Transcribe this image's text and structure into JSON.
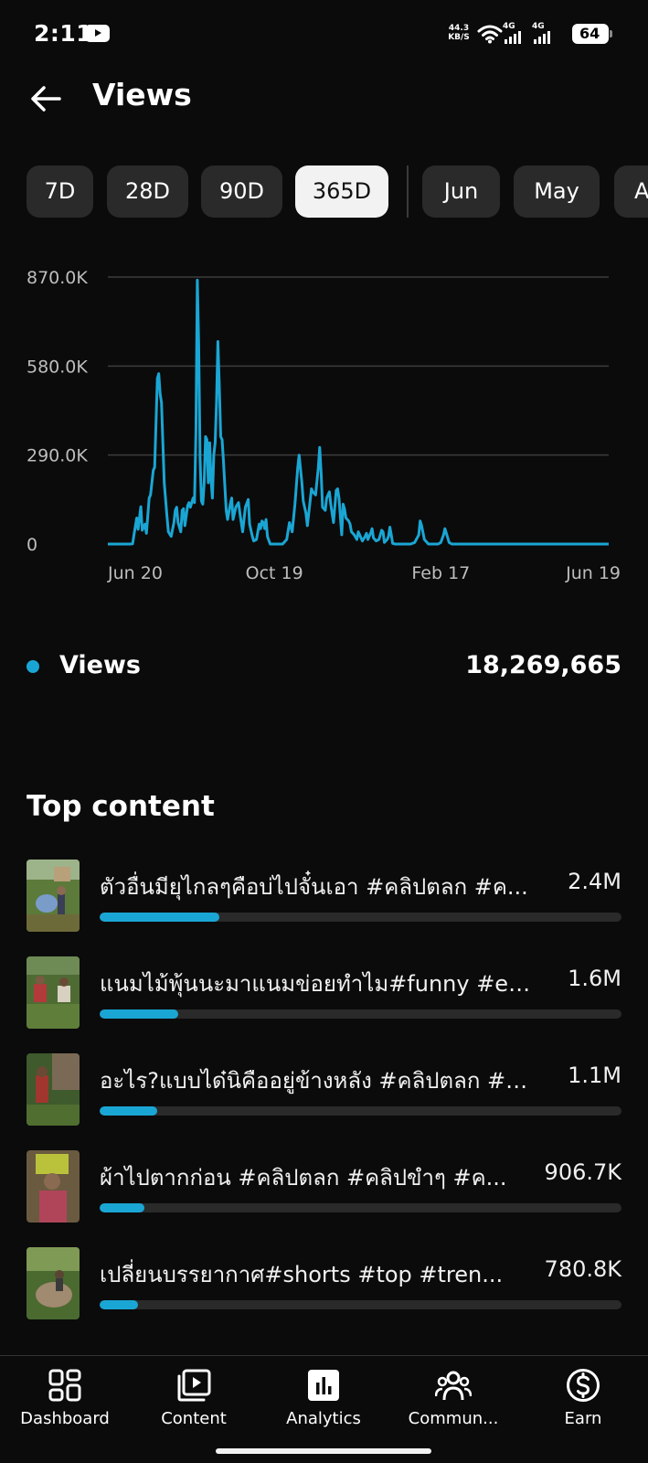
{
  "status_bar": {
    "time": "2:11",
    "net_speed_value": "44.3",
    "net_speed_unit": "KB/S",
    "signal1_label": "4G",
    "signal2_label": "4G",
    "battery": "64"
  },
  "header": {
    "title": "Views"
  },
  "periods": [
    {
      "label": "7D",
      "active": false
    },
    {
      "label": "28D",
      "active": false
    },
    {
      "label": "90D",
      "active": false
    },
    {
      "label": "365D",
      "active": true
    },
    {
      "label": "Jun",
      "active": false
    },
    {
      "label": "May",
      "active": false
    },
    {
      "label": "A",
      "active": false
    }
  ],
  "colors": {
    "accent": "#1aa6d4",
    "background": "#0b0b0b",
    "chip": "#2a2a2a",
    "chip_active": "#f2f2f2",
    "grid": "#3d3d3d"
  },
  "chart_data": {
    "type": "line",
    "title": "",
    "xlabel": "",
    "ylabel": "",
    "y_ticks": [
      "870.0K",
      "580.0K",
      "290.0K",
      "0"
    ],
    "y_tick_values": [
      870000,
      580000,
      290000,
      0
    ],
    "x_ticks": [
      "Jun 20",
      "Oct 19",
      "Feb 17",
      "Jun 19"
    ],
    "x_tick_days": [
      0,
      121,
      242,
      364
    ],
    "ylim": [
      0,
      870000
    ],
    "xlim": [
      0,
      364
    ],
    "grid": true,
    "series": [
      {
        "name": "Views",
        "points": [
          [
            0,
            0
          ],
          [
            16,
            0
          ],
          [
            18,
            1000
          ],
          [
            19,
            30000
          ],
          [
            21,
            85000
          ],
          [
            22,
            48000
          ],
          [
            24,
            122000
          ],
          [
            25,
            45000
          ],
          [
            27,
            65000
          ],
          [
            28,
            35000
          ],
          [
            30,
            150000
          ],
          [
            31,
            160000
          ],
          [
            33,
            240000
          ],
          [
            34,
            250000
          ],
          [
            36,
            540000
          ],
          [
            37,
            555000
          ],
          [
            38,
            490000
          ],
          [
            39,
            460000
          ],
          [
            41,
            200000
          ],
          [
            43,
            90000
          ],
          [
            44,
            40000
          ],
          [
            46,
            25000
          ],
          [
            48,
            70000
          ],
          [
            49,
            110000
          ],
          [
            50,
            120000
          ],
          [
            51,
            70000
          ],
          [
            53,
            40000
          ],
          [
            54,
            110000
          ],
          [
            55,
            115000
          ],
          [
            56,
            60000
          ],
          [
            58,
            125000
          ],
          [
            59,
            135000
          ],
          [
            60,
            120000
          ],
          [
            62,
            150000
          ],
          [
            63,
            135000
          ],
          [
            64,
            370000
          ],
          [
            65,
            860000
          ],
          [
            66,
            650000
          ],
          [
            67,
            280000
          ],
          [
            68,
            140000
          ],
          [
            69,
            130000
          ],
          [
            70,
            200000
          ],
          [
            71,
            350000
          ],
          [
            72,
            340000
          ],
          [
            73,
            200000
          ],
          [
            74,
            330000
          ],
          [
            75,
            210000
          ],
          [
            76,
            150000
          ],
          [
            77,
            290000
          ],
          [
            78,
            330000
          ],
          [
            79,
            460000
          ],
          [
            80,
            660000
          ],
          [
            81,
            520000
          ],
          [
            82,
            350000
          ],
          [
            83,
            340000
          ],
          [
            84,
            270000
          ],
          [
            86,
            110000
          ],
          [
            87,
            80000
          ],
          [
            89,
            130000
          ],
          [
            90,
            150000
          ],
          [
            91,
            80000
          ],
          [
            93,
            120000
          ],
          [
            95,
            135000
          ],
          [
            96,
            100000
          ],
          [
            98,
            40000
          ],
          [
            99,
            80000
          ],
          [
            100,
            120000
          ],
          [
            102,
            145000
          ],
          [
            103,
            65000
          ],
          [
            105,
            25000
          ],
          [
            106,
            10000
          ],
          [
            108,
            15000
          ],
          [
            110,
            65000
          ],
          [
            111,
            50000
          ],
          [
            112,
            75000
          ],
          [
            113,
            70000
          ],
          [
            114,
            50000
          ],
          [
            115,
            80000
          ],
          [
            116,
            25000
          ],
          [
            118,
            0
          ],
          [
            127,
            0
          ],
          [
            130,
            15000
          ],
          [
            132,
            70000
          ],
          [
            134,
            40000
          ],
          [
            136,
            130000
          ],
          [
            138,
            250000
          ],
          [
            139,
            290000
          ],
          [
            141,
            200000
          ],
          [
            142,
            140000
          ],
          [
            144,
            100000
          ],
          [
            145,
            60000
          ],
          [
            147,
            140000
          ],
          [
            148,
            180000
          ],
          [
            149,
            170000
          ],
          [
            151,
            160000
          ],
          [
            153,
            250000
          ],
          [
            154,
            315000
          ],
          [
            155,
            230000
          ],
          [
            156,
            120000
          ],
          [
            158,
            110000
          ],
          [
            159,
            150000
          ],
          [
            161,
            170000
          ],
          [
            162,
            130000
          ],
          [
            164,
            70000
          ],
          [
            166,
            175000
          ],
          [
            167,
            180000
          ],
          [
            168,
            150000
          ],
          [
            170,
            30000
          ],
          [
            171,
            130000
          ],
          [
            172,
            115000
          ],
          [
            173,
            85000
          ],
          [
            175,
            75000
          ],
          [
            176,
            65000
          ],
          [
            177,
            40000
          ],
          [
            179,
            30000
          ],
          [
            181,
            15000
          ],
          [
            182,
            40000
          ],
          [
            183,
            30000
          ],
          [
            185,
            10000
          ],
          [
            187,
            25000
          ],
          [
            188,
            35000
          ],
          [
            189,
            15000
          ],
          [
            191,
            35000
          ],
          [
            192,
            50000
          ],
          [
            193,
            20000
          ],
          [
            195,
            10000
          ],
          [
            197,
            15000
          ],
          [
            199,
            45000
          ],
          [
            200,
            40000
          ],
          [
            201,
            5000
          ],
          [
            203,
            15000
          ],
          [
            204,
            25000
          ],
          [
            205,
            55000
          ],
          [
            206,
            30000
          ],
          [
            207,
            2000
          ],
          [
            209,
            0
          ],
          [
            220,
            0
          ],
          [
            223,
            5000
          ],
          [
            226,
            30000
          ],
          [
            227,
            75000
          ],
          [
            228,
            60000
          ],
          [
            230,
            15000
          ],
          [
            233,
            0
          ],
          [
            240,
            0
          ],
          [
            242,
            5000
          ],
          [
            244,
            30000
          ],
          [
            245,
            50000
          ],
          [
            246,
            35000
          ],
          [
            248,
            5000
          ],
          [
            250,
            0
          ],
          [
            364,
            0
          ]
        ]
      }
    ]
  },
  "summary": {
    "label": "Views",
    "value": "18,269,665"
  },
  "top_content": {
    "title": "Top content",
    "items": [
      {
        "title": "ตัวอื่นมียุไกลๆคือบ่ไปจั๋นเอา #คลิปตลก #ค...",
        "value": "2.4M",
        "fraction": 0.23
      },
      {
        "title": "แนมไม้พุ้นนะมาแนมข่อยทำไม#funny #en...",
        "value": "1.6M",
        "fraction": 0.15
      },
      {
        "title": "อะไร?แบบได๋นิคืออยู่ข้างหลัง #คลิปตลก #ค...",
        "value": "1.1M",
        "fraction": 0.11
      },
      {
        "title": "ผ้าไปตากก่อน #คลิปตลก #คลิปขำๆ #ค...",
        "value": "906.7K",
        "fraction": 0.086
      },
      {
        "title": "เปลี่ยนบรรยากาศ#shorts #top #tren...",
        "value": "780.8K",
        "fraction": 0.074
      }
    ]
  },
  "bottom_nav": [
    {
      "label": "Dashboard",
      "icon": "dashboard-icon"
    },
    {
      "label": "Content",
      "icon": "content-icon"
    },
    {
      "label": "Analytics",
      "icon": "analytics-icon"
    },
    {
      "label": "Commun...",
      "icon": "community-icon"
    },
    {
      "label": "Earn",
      "icon": "earn-icon"
    }
  ]
}
